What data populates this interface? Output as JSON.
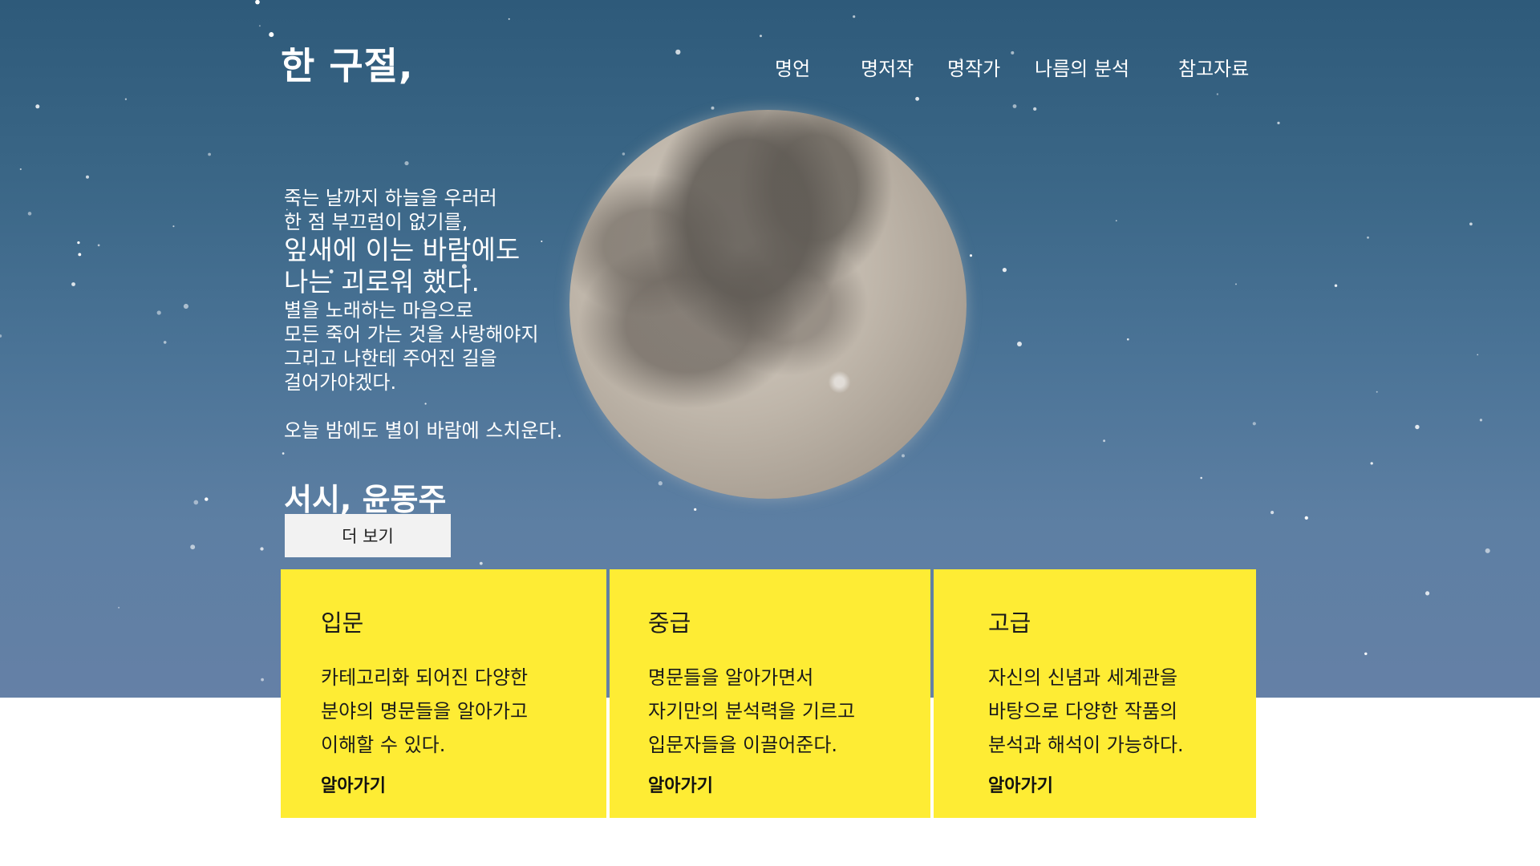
{
  "header": {
    "brand": "한 구절,",
    "nav": [
      {
        "label": "명언"
      },
      {
        "label": "명저작"
      },
      {
        "label": "명작가"
      },
      {
        "label": "나름의 분석"
      },
      {
        "label": "참고자료"
      }
    ]
  },
  "hero": {
    "poem_lines": [
      "죽는 날까지 하늘을 우러러",
      "한 점 부끄럼이 없기를,",
      "잎새에 이는 바람에도",
      "나는 괴로워 했다.",
      "별을 노래하는 마음으로",
      "모든 죽어 가는 것을 사랑해야지",
      "그리고 나한테 주어진 길을",
      "걸어가야겠다.",
      "오늘 밤에도 별이 바람에 스치운다."
    ],
    "author": "서시, 윤동주",
    "more_button": "더 보기"
  },
  "cards": [
    {
      "title": "입문",
      "description": "카테고리화 되어진 다양한\n분야의 명문들을 알아가고\n이해할 수 있다.",
      "link": "알아가기"
    },
    {
      "title": "중급",
      "description": "명문들을 알아가면서\n자기만의 분석력을 기르고\n입문자들을 이끌어준다.",
      "link": "알아가기"
    },
    {
      "title": "고급",
      "description": "자신의 신념과 세계관을\n바탕으로 다양한 작품의\n분석과 해석이 가능하다.",
      "link": "알아가기"
    }
  ],
  "colors": {
    "sky_top": "#2e5a7a",
    "sky_bottom": "#6580a6",
    "card_yellow": "#feec34",
    "button_bg": "#f2f2f2"
  }
}
